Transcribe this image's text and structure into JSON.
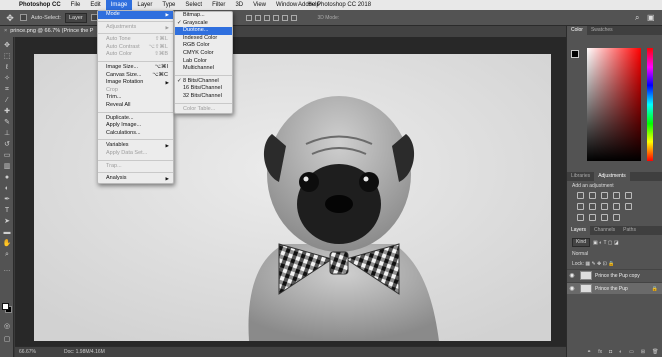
{
  "menubar": {
    "apple_icon": "apple-icon",
    "items": [
      "Photoshop CC",
      "File",
      "Edit",
      "Image",
      "Layer",
      "Type",
      "Select",
      "Filter",
      "3D",
      "View",
      "Window",
      "Help"
    ],
    "active": "Image",
    "window_title": "Adobe Photoshop CC 2018"
  },
  "optbar": {
    "auto_select": "Auto-Select:",
    "target": "Layer",
    "transform": "Sh",
    "mode3d": "3D Mode:"
  },
  "doc_tab": {
    "title": "prince.png @ 66.7% (Prince the P"
  },
  "status": {
    "zoom": "66.67%",
    "doc": "Doc: 1.98M/4.16M"
  },
  "image_menu": {
    "items": [
      {
        "label": "Mode",
        "type": "submenu",
        "highlight": true
      },
      {
        "type": "sep"
      },
      {
        "label": "Adjustments",
        "type": "submenu",
        "disabled": true
      },
      {
        "type": "sep"
      },
      {
        "label": "Auto Tone",
        "shortcut": "⇧⌘L",
        "disabled": true
      },
      {
        "label": "Auto Contrast",
        "shortcut": "⌥⇧⌘L",
        "disabled": true
      },
      {
        "label": "Auto Color",
        "shortcut": "⇧⌘B",
        "disabled": true
      },
      {
        "type": "sep"
      },
      {
        "label": "Image Size...",
        "shortcut": "⌥⌘I"
      },
      {
        "label": "Canvas Size...",
        "shortcut": "⌥⌘C"
      },
      {
        "label": "Image Rotation",
        "type": "submenu"
      },
      {
        "label": "Crop",
        "disabled": true
      },
      {
        "label": "Trim..."
      },
      {
        "label": "Reveal All"
      },
      {
        "type": "sep"
      },
      {
        "label": "Duplicate..."
      },
      {
        "label": "Apply Image..."
      },
      {
        "label": "Calculations..."
      },
      {
        "type": "sep"
      },
      {
        "label": "Variables",
        "type": "submenu"
      },
      {
        "label": "Apply Data Set...",
        "disabled": true
      },
      {
        "type": "sep"
      },
      {
        "label": "Trap...",
        "disabled": true
      },
      {
        "type": "sep"
      },
      {
        "label": "Analysis",
        "type": "submenu"
      }
    ]
  },
  "mode_menu": {
    "items": [
      {
        "label": "Bitmap..."
      },
      {
        "label": "Grayscale",
        "checked": true
      },
      {
        "label": "Duotone...",
        "highlight": true
      },
      {
        "label": "Indexed Color"
      },
      {
        "label": "RGB Color"
      },
      {
        "label": "CMYK Color"
      },
      {
        "label": "Lab Color"
      },
      {
        "label": "Multichannel"
      },
      {
        "type": "sep"
      },
      {
        "label": "8 Bits/Channel",
        "checked": true
      },
      {
        "label": "16 Bits/Channel"
      },
      {
        "label": "32 Bits/Channel"
      },
      {
        "type": "sep"
      },
      {
        "label": "Color Table...",
        "disabled": true
      }
    ]
  },
  "color_panel": {
    "tabs": [
      "Color",
      "Swatches"
    ],
    "active": "Color"
  },
  "adjust_panel": {
    "tabs": [
      "Libraries",
      "Adjustments"
    ],
    "active": "Adjustments",
    "title": "Add an adjustment"
  },
  "layers_panel": {
    "tabs": [
      "Layers",
      "Channels",
      "Paths"
    ],
    "active": "Layers",
    "kind": "Kind",
    "blend": "Normal",
    "lock": "Lock:",
    "layers": [
      {
        "name": "Prince the Pup copy",
        "selected": false
      },
      {
        "name": "Prince the Pup",
        "selected": true
      }
    ]
  },
  "icons": {
    "move": "move-tool-icon",
    "marquee": "marquee-icon",
    "lasso": "lasso-icon",
    "wand": "magic-wand-icon",
    "crop": "crop-icon",
    "eyedropper": "eyedropper-icon",
    "heal": "healing-icon",
    "brush": "brush-icon",
    "stamp": "stamp-icon",
    "history": "history-brush-icon",
    "eraser": "eraser-icon",
    "gradient": "gradient-icon",
    "blur": "blur-icon",
    "dodge": "dodge-icon",
    "pen": "pen-icon",
    "type": "type-icon",
    "path": "path-select-icon",
    "shape": "shape-icon",
    "hand": "hand-icon",
    "zoom": "zoom-icon"
  }
}
